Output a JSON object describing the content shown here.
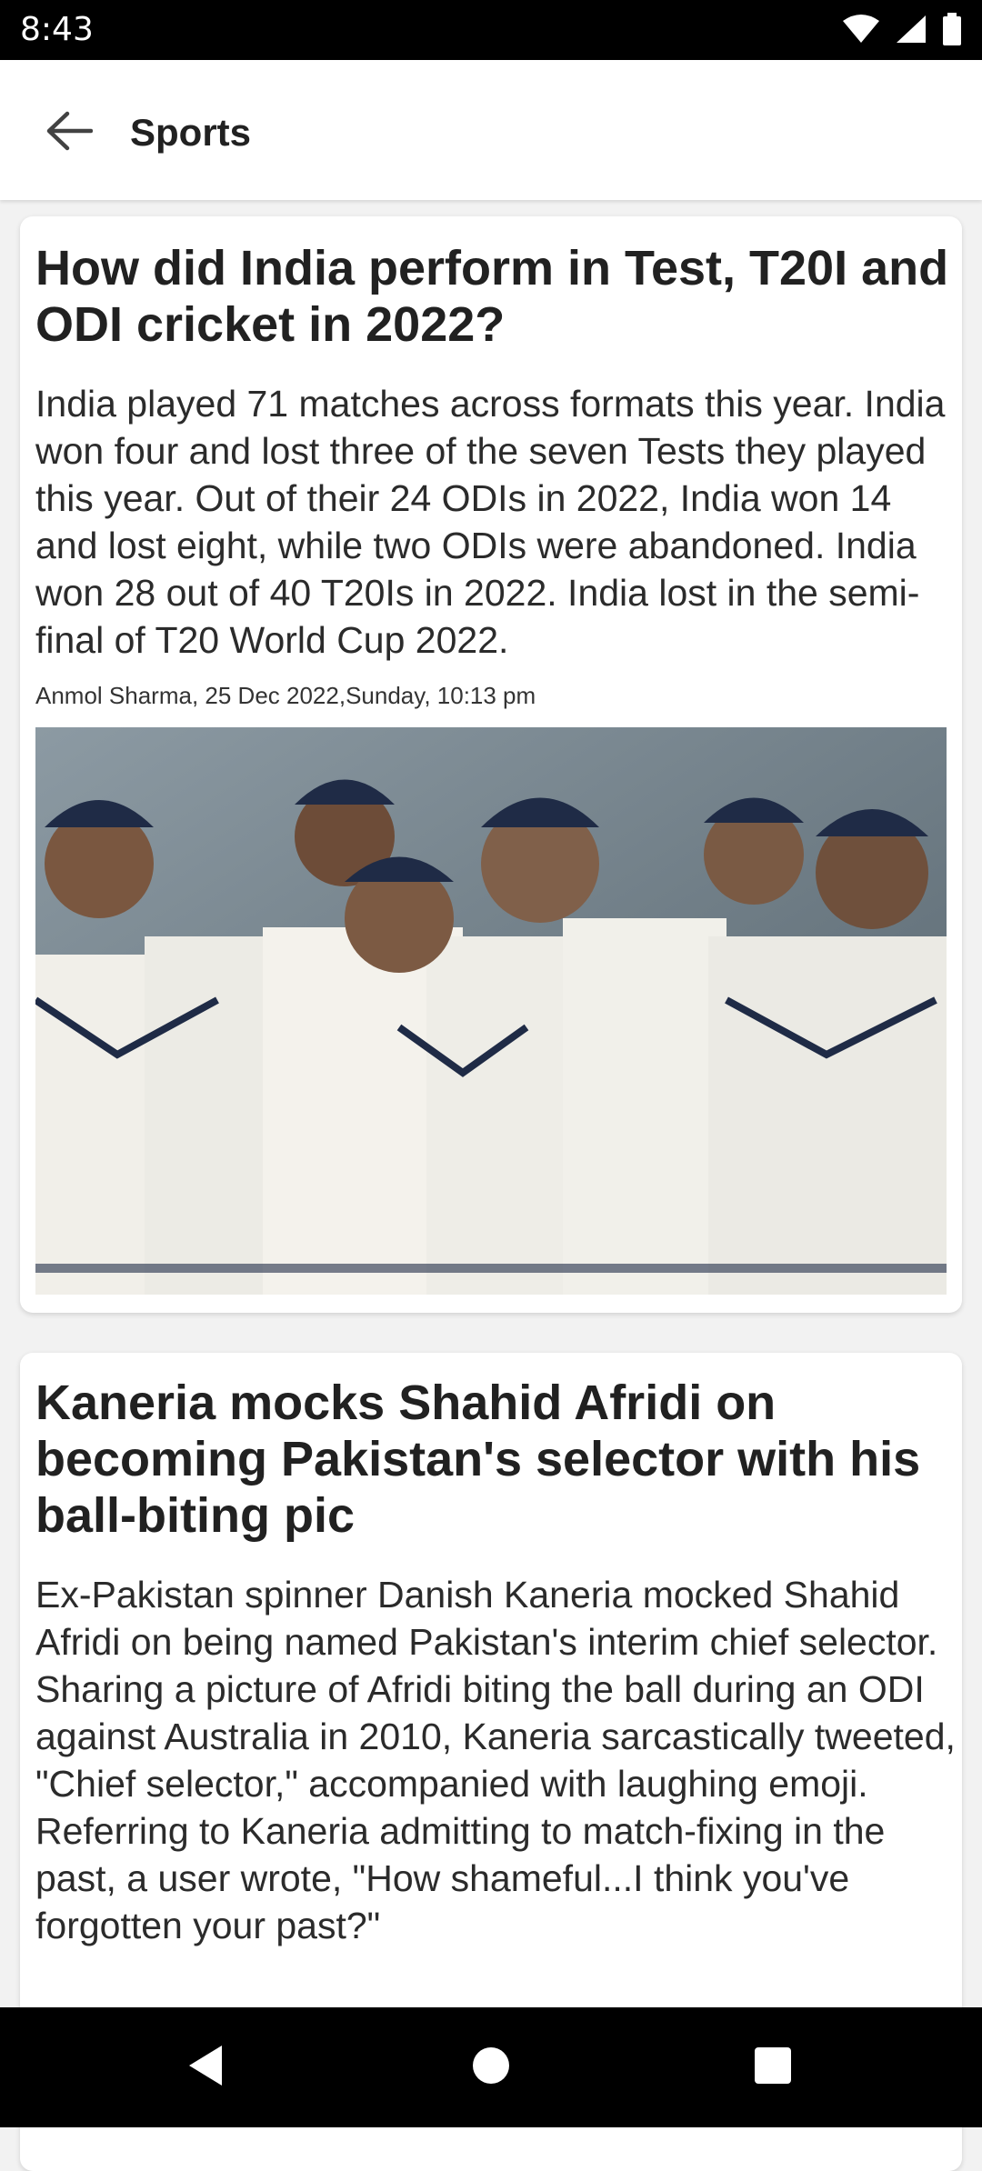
{
  "status_bar": {
    "time": "8:43",
    "icons": [
      "wifi-icon",
      "cellular-signal-icon",
      "battery-icon"
    ]
  },
  "app_bar": {
    "title": "Sports",
    "back_icon": "arrow-left-icon"
  },
  "articles": [
    {
      "title": "How did India perform in Test, T20I and ODI cricket in 2022?",
      "body": "India played 71 matches across formats this year. India won four and lost three of the seven Tests they played this year. Out of their 24 ODIs in 2022, India won 14 and lost eight, while two ODIs were abandoned. India won 28 out of 40 T20Is in 2022. India lost in the semi-final of T20 World Cup 2022.",
      "meta": "Anmol Sharma, 25 Dec 2022,Sunday, 10:13 pm",
      "image": "photo of Indian cricket team celebrating"
    },
    {
      "title": "Kaneria mocks Shahid Afridi on becoming Pakistan's selector with his ball-biting pic",
      "body": "Ex-Pakistan spinner Danish Kaneria mocked Shahid Afridi on being named Pakistan's interim chief selector. Sharing a picture of Afridi biting the ball during an ODI against Australia in 2010, Kaneria sarcastically tweeted, \"Chief selector,\" accompanied with laughing emoji. Referring to Kaneria admitting to match-fixing in the past, a user wrote, \"How shameful...I think you've forgotten your past?\""
    }
  ],
  "nav_bar": {
    "icons": [
      "back-triangle-icon",
      "home-circle-icon",
      "recents-square-icon"
    ]
  }
}
